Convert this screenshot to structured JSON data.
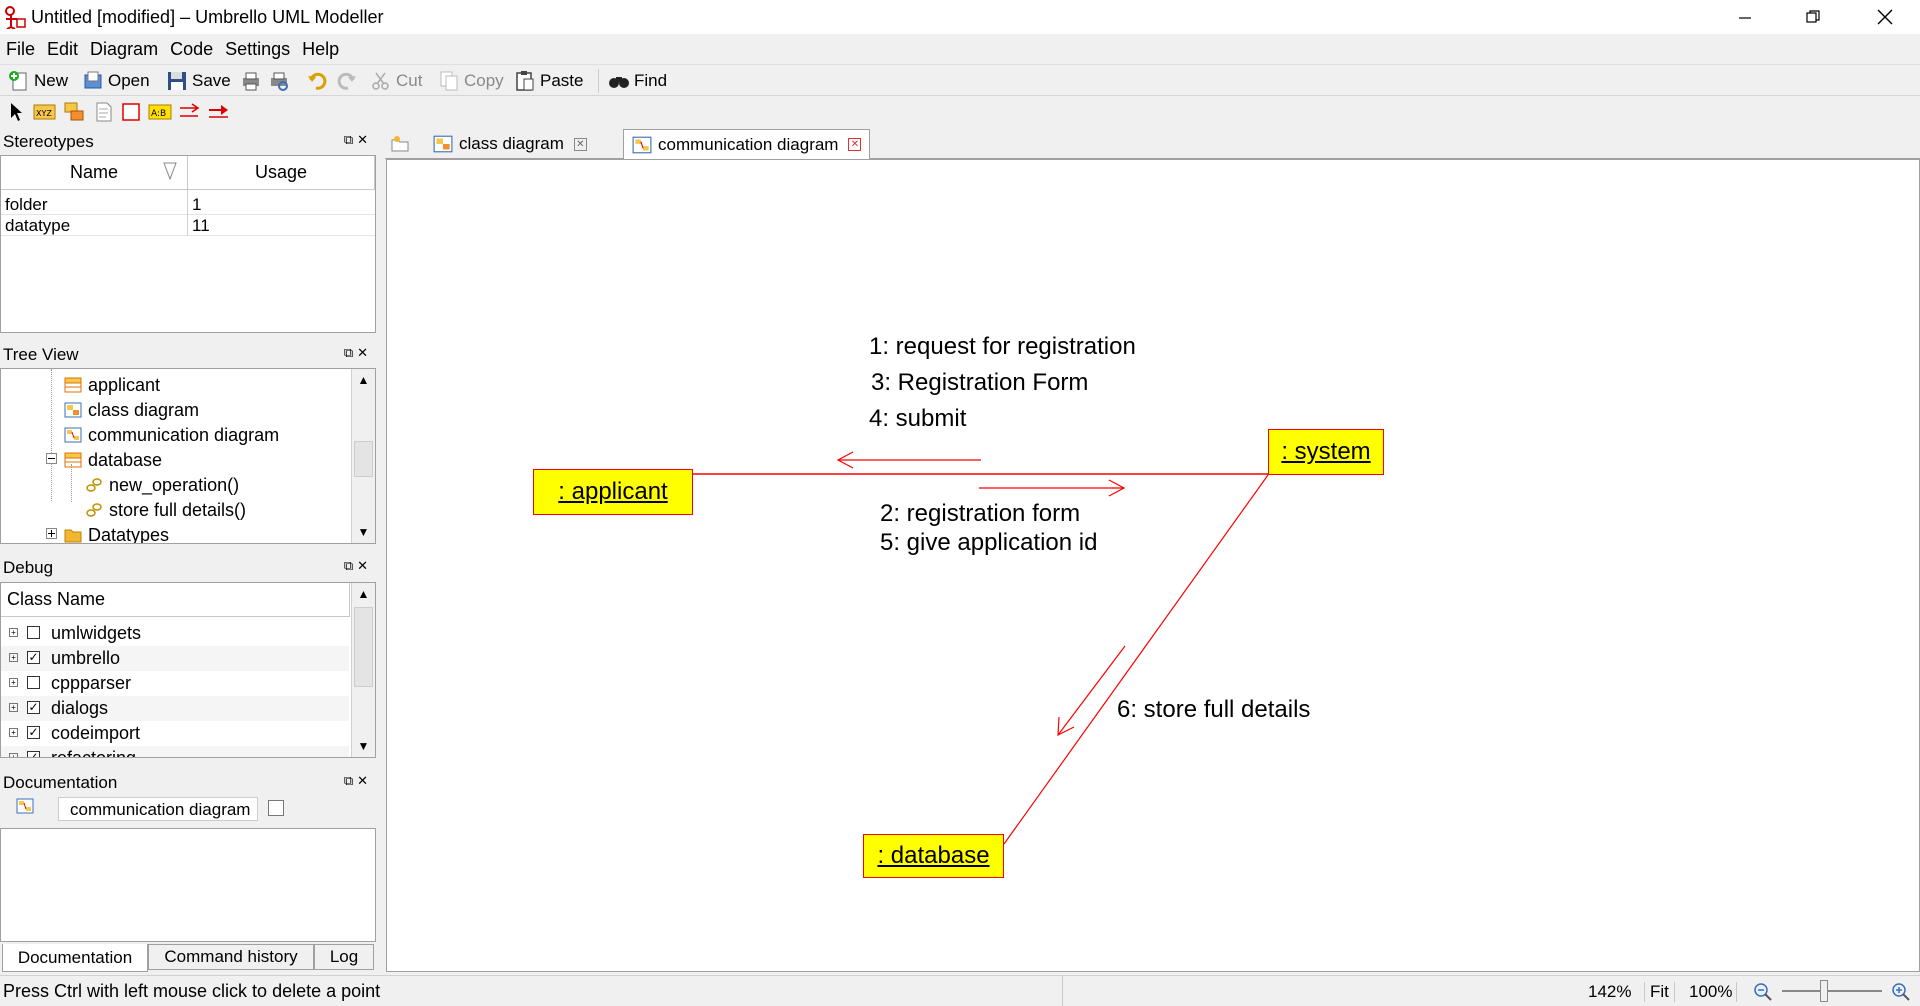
{
  "window": {
    "title": "Untitled [modified] – Umbrello UML Modeller",
    "controls": [
      "minimize",
      "restore",
      "close"
    ]
  },
  "menu": [
    "File",
    "Edit",
    "Diagram",
    "Code",
    "Settings",
    "Help"
  ],
  "toolbar": {
    "new": "New",
    "open": "Open",
    "save": "Save",
    "cut": "Cut",
    "copy": "Copy",
    "paste": "Paste",
    "find": "Find"
  },
  "stereotypes": {
    "title": "Stereotypes",
    "col_name": "Name",
    "col_usage": "Usage",
    "rows": [
      {
        "name": "folder",
        "usage": "1"
      },
      {
        "name": "datatype",
        "usage": "11"
      }
    ]
  },
  "tree": {
    "title": "Tree View",
    "items": [
      "applicant",
      "class diagram",
      "communication diagram",
      "database",
      "new_operation()",
      "store full details()",
      "Datatypes"
    ]
  },
  "debug": {
    "title": "Debug",
    "col": "Class Name",
    "rows": [
      {
        "label": "umlwidgets",
        "checked": false
      },
      {
        "label": "umbrello",
        "checked": true
      },
      {
        "label": "cppparser",
        "checked": false
      },
      {
        "label": "dialogs",
        "checked": true
      },
      {
        "label": "codeimport",
        "checked": true
      },
      {
        "label": "refactoring",
        "checked": true
      }
    ]
  },
  "documentation": {
    "title": "Documentation",
    "field": "communication diagram",
    "tabs": [
      "Documentation",
      "Command history",
      "Log"
    ]
  },
  "tabs": [
    {
      "label": "class diagram",
      "active": false
    },
    {
      "label": "communication diagram",
      "active": true
    }
  ],
  "diagram": {
    "objects": {
      "applicant": ": applicant",
      "system": ": system",
      "database": ": database"
    },
    "messages": {
      "m1": "1: request for registration",
      "m3": "3: Registration Form",
      "m4": "4: submit",
      "m2": "2: registration form",
      "m5": "5: give application id",
      "m6": "6: store full details"
    },
    "colors": {
      "object_fill": "#ffff00",
      "line": "#ff0000"
    }
  },
  "status": {
    "message": "Press Ctrl with left mouse click to delete a point",
    "zoom": "142%",
    "fit": "Fit",
    "reset": "100%"
  }
}
